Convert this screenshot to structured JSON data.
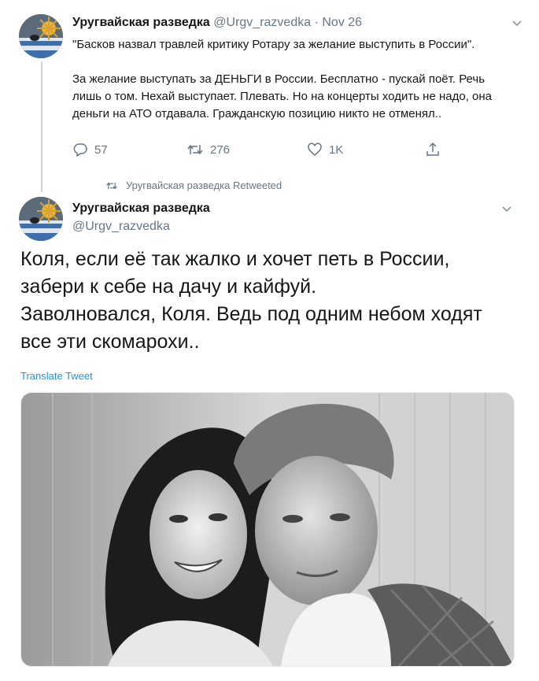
{
  "tweet1": {
    "author_name": "Уругвайская разведка",
    "author_handle": "@Urgv_razvedka",
    "separator": "·",
    "date": "Nov 26",
    "quote_text": "\"Басков назвал травлей критику Ротару за желание выступить в России\".",
    "body_text": "За желание выступать за ДЕНЬГИ в России. Бесплатно - пускай поёт. Речь лишь о том. Нехай выступает. Плевать. Но на концерты ходить не надо, она деньги на АТО отдавала. Гражданскую позицию никто не отменял..",
    "reply_count": "57",
    "retweet_count": "276",
    "like_count": "1K"
  },
  "retweet_note": "Уругвайская разведка Retweeted",
  "tweet2": {
    "author_name": "Уругвайская разведка",
    "author_handle": "@Urgv_razvedka",
    "body_lines": [
      "Коля, если её так жалко и хочет петь в России,",
      "забери к себе на дачу и кайфуй.",
      "Заволновался, Коля. Ведь под одним небом ходят",
      "все эти скомарохи.."
    ],
    "translate_label": "Translate Tweet"
  },
  "icons": {
    "reply": "reply-icon",
    "retweet": "retweet-icon",
    "like": "heart-icon",
    "share": "share-icon",
    "caret": "chevron-down-icon"
  },
  "colors": {
    "secondary_text": "#657786",
    "link": "#1b95e0",
    "thread_line": "#ccd6dd"
  }
}
